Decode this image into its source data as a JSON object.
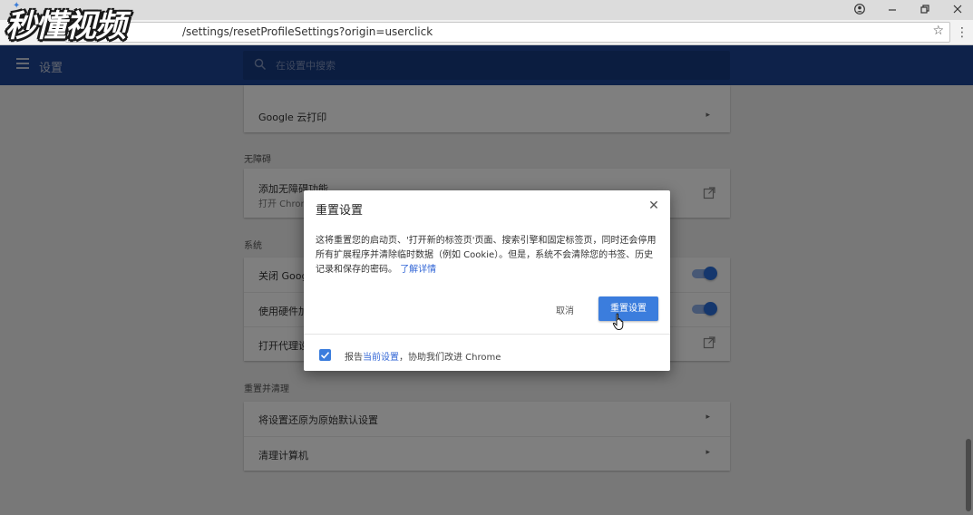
{
  "browser": {
    "url": "/settings/resetProfileSettings?origin=userclick",
    "window_controls": [
      "account",
      "minimize",
      "restore",
      "close"
    ]
  },
  "watermark": {
    "text": "秒懂视频"
  },
  "header": {
    "title": "设置",
    "search_placeholder": "在设置中搜索"
  },
  "content": {
    "cloud_print": "Google 云打印",
    "accessibility": {
      "section_title": "无障碍",
      "add_label": "添加无障碍功能",
      "add_sub": "打开 Chrom"
    },
    "system": {
      "section_title": "系统",
      "rows": [
        {
          "label": "关闭 Googl",
          "control": "toggle",
          "on": true
        },
        {
          "label": "使用硬件加",
          "control": "toggle",
          "on": true
        },
        {
          "label": "打开代理设",
          "control": "external"
        }
      ]
    },
    "reset": {
      "section_title": "重置并清理",
      "rows": [
        {
          "label": "将设置还原为原始默认设置"
        },
        {
          "label": "清理计算机"
        }
      ]
    }
  },
  "dialog": {
    "title": "重置设置",
    "body": "这将重置您的启动页、'打开新的标签页'页面、搜索引擎和固定标签页，同时还会停用所有扩展程序并清除临时数据（例如 Cookie）。但是，系统不会清除您的书签、历史记录和保存的密码。",
    "learn_more": "了解详情",
    "cancel_label": "取消",
    "reset_label": "重置设置",
    "footer": {
      "checked": true,
      "prefix": "报告",
      "link": "当前设置",
      "suffix": "，协助我们改进 Chrome"
    }
  },
  "colors": {
    "header_bg": "#1c4494",
    "accent": "#3b7ddd",
    "link": "#3367d6"
  }
}
